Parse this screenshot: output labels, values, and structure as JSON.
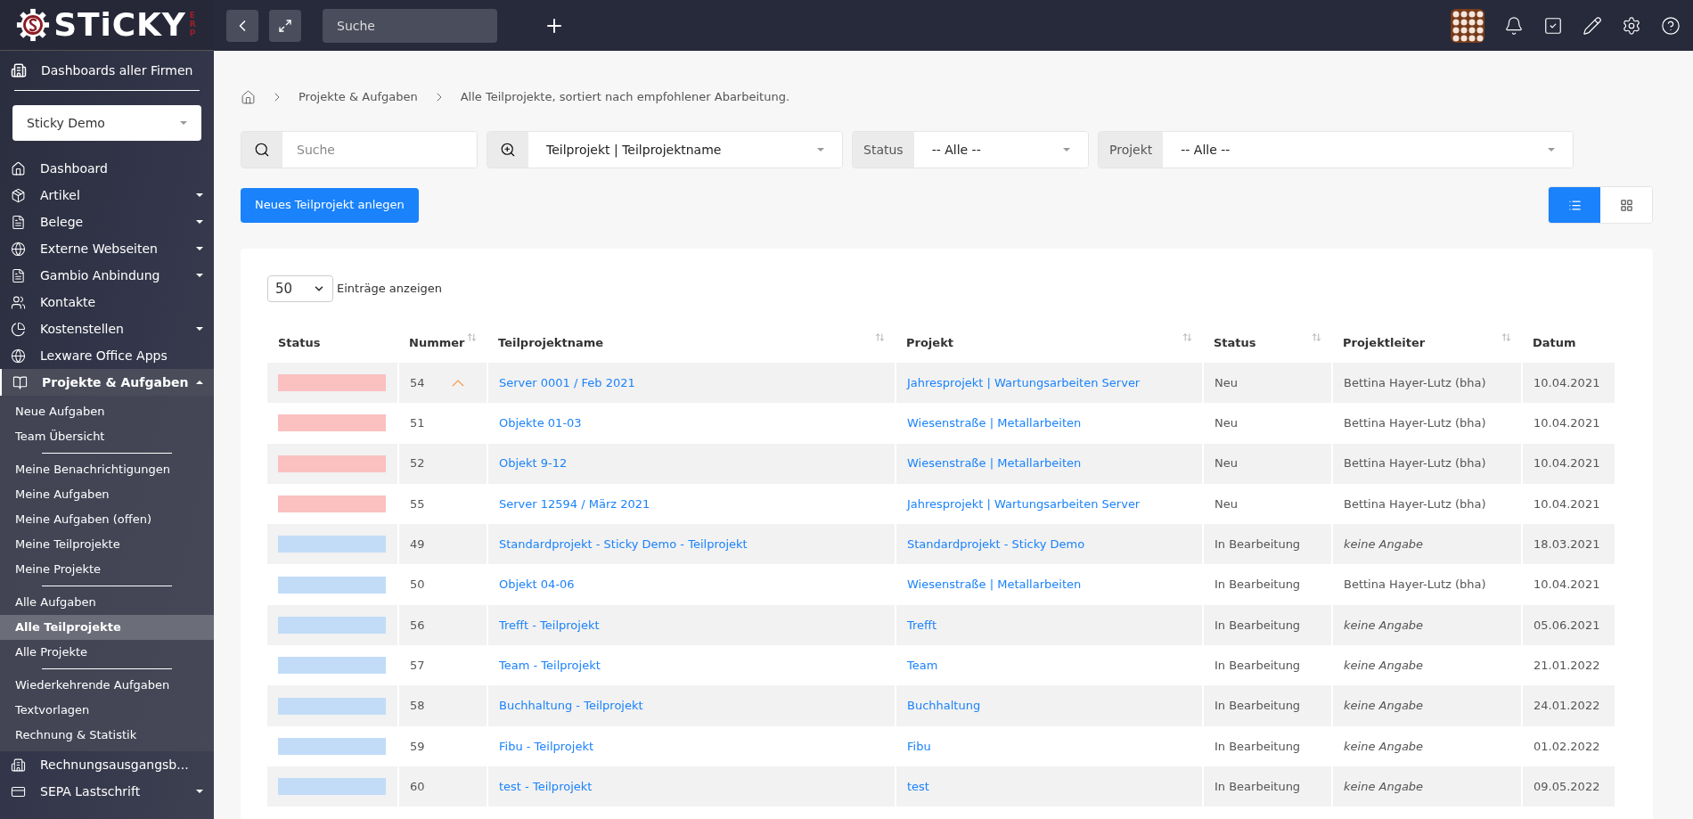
{
  "logo": {
    "text": "STiCKY",
    "suffix": "ERP"
  },
  "topbar": {
    "search_placeholder": "Suche"
  },
  "sidebar": {
    "dashboards_all": "Dashboards aller Firmen",
    "company": "Sticky Demo",
    "items": [
      {
        "label": "Dashboard",
        "kind": "home",
        "has_caret": false,
        "expanded": false
      },
      {
        "label": "Artikel",
        "kind": "box",
        "has_caret": true,
        "expanded": false
      },
      {
        "label": "Belege",
        "kind": "doc",
        "has_caret": true,
        "expanded": false
      },
      {
        "label": "Externe Webseiten",
        "kind": "globe",
        "has_caret": true,
        "expanded": false
      },
      {
        "label": "Gambio Anbindung",
        "kind": "doc",
        "has_caret": true,
        "expanded": false
      },
      {
        "label": "Kontakte",
        "kind": "users",
        "has_caret": false,
        "expanded": false
      },
      {
        "label": "Kostenstellen",
        "kind": "pie",
        "has_caret": true,
        "expanded": false
      },
      {
        "label": "Lexware Office Apps",
        "kind": "globe",
        "has_caret": false,
        "expanded": false
      },
      {
        "label": "Projekte & Aufgaben",
        "kind": "book",
        "has_caret": true,
        "expanded": true,
        "children": [
          {
            "label": "Neue Aufgaben",
            "selected": false
          },
          {
            "label": "Team Übersicht",
            "selected": false,
            "divider_after": true
          },
          {
            "label": "Meine Benachrichtigungen",
            "selected": false
          },
          {
            "label": "Meine Aufgaben",
            "selected": false
          },
          {
            "label": "Meine Aufgaben (offen)",
            "selected": false
          },
          {
            "label": "Meine Teilprojekte",
            "selected": false
          },
          {
            "label": "Meine Projekte",
            "selected": false,
            "divider_after": true
          },
          {
            "label": "Alle Aufgaben",
            "selected": false
          },
          {
            "label": "Alle Teilprojekte",
            "selected": true
          },
          {
            "label": "Alle Projekte",
            "selected": false,
            "divider_after": true
          },
          {
            "label": "Wiederkehrende Aufgaben",
            "selected": false
          },
          {
            "label": "Textvorlagen",
            "selected": false
          },
          {
            "label": "Rechnung & Statistik",
            "selected": false
          }
        ]
      },
      {
        "label": "Rechnungsausgangsb...",
        "kind": "building",
        "has_caret": false,
        "expanded": false
      },
      {
        "label": "SEPA Lastschrift",
        "kind": "card",
        "has_caret": true,
        "expanded": false
      }
    ]
  },
  "breadcrumb": [
    "Projekte & Aufgaben",
    "Alle Teilprojekte, sortiert nach empfohlener Abarbeitung."
  ],
  "filters": {
    "search_placeholder": "Suche",
    "field": "Teilprojekt | Teilprojektname",
    "status_label": "Status",
    "status_value": "-- Alle --",
    "project_label": "Projekt",
    "project_value": "-- Alle --"
  },
  "new_button": "Neues Teilprojekt anlegen",
  "view_toggle": [
    {
      "kind": "list",
      "selected": true
    },
    {
      "kind": "grid",
      "selected": false
    }
  ],
  "page_size": {
    "value": "50",
    "label": "Einträge anzeigen"
  },
  "table": {
    "columns": [
      {
        "label": "Status",
        "sortable": false
      },
      {
        "label": "Nummer",
        "sortable": true
      },
      {
        "label": "Teilprojektname",
        "sortable": true
      },
      {
        "label": "Projekt",
        "sortable": true
      },
      {
        "label": "Status",
        "sortable": true
      },
      {
        "label": "Projektleiter",
        "sortable": true
      },
      {
        "label": "Datum",
        "sortable": false
      }
    ],
    "rows": [
      {
        "color": "#fbc0c0",
        "number": "54",
        "priority_up": true,
        "name": "Server 0001 / Feb 2021",
        "project": "Jahresprojekt | Wartungsarbeiten Server",
        "status": "Neu",
        "leader": "Bettina Hayer-Lutz (bha)",
        "leader_unspecified": false,
        "date": "10.04.2021"
      },
      {
        "color": "#fbc0c0",
        "number": "51",
        "priority_up": false,
        "name": "Objekte 01-03",
        "project": "Wiesenstraße | Metallarbeiten",
        "status": "Neu",
        "leader": "Bettina Hayer-Lutz (bha)",
        "leader_unspecified": false,
        "date": "10.04.2021"
      },
      {
        "color": "#fbc0c0",
        "number": "52",
        "priority_up": false,
        "name": "Objekt 9-12",
        "project": "Wiesenstraße | Metallarbeiten",
        "status": "Neu",
        "leader": "Bettina Hayer-Lutz (bha)",
        "leader_unspecified": false,
        "date": "10.04.2021"
      },
      {
        "color": "#fbc0c0",
        "number": "55",
        "priority_up": false,
        "name": "Server 12594 / März 2021",
        "project": "Jahresprojekt | Wartungsarbeiten Server",
        "status": "Neu",
        "leader": "Bettina Hayer-Lutz (bha)",
        "leader_unspecified": false,
        "date": "10.04.2021"
      },
      {
        "color": "#c2dcf8",
        "number": "49",
        "priority_up": false,
        "name": "Standardprojekt - Sticky Demo - Teilprojekt",
        "project": "Standardprojekt - Sticky Demo",
        "status": "In Bearbeitung",
        "leader": "keine Angabe",
        "leader_unspecified": true,
        "date": "18.03.2021"
      },
      {
        "color": "#c2dcf8",
        "number": "50",
        "priority_up": false,
        "name": "Objekt 04-06",
        "project": "Wiesenstraße | Metallarbeiten",
        "status": "In Bearbeitung",
        "leader": "Bettina Hayer-Lutz (bha)",
        "leader_unspecified": false,
        "date": "10.04.2021"
      },
      {
        "color": "#c2dcf8",
        "number": "56",
        "priority_up": false,
        "name": "Trefft - Teilprojekt",
        "project": "Trefft",
        "status": "In Bearbeitung",
        "leader": "keine Angabe",
        "leader_unspecified": true,
        "date": "05.06.2021"
      },
      {
        "color": "#c2dcf8",
        "number": "57",
        "priority_up": false,
        "name": "Team - Teilprojekt",
        "project": "Team",
        "status": "In Bearbeitung",
        "leader": "keine Angabe",
        "leader_unspecified": true,
        "date": "21.01.2022"
      },
      {
        "color": "#c2dcf8",
        "number": "58",
        "priority_up": false,
        "name": "Buchhaltung - Teilprojekt",
        "project": "Buchhaltung",
        "status": "In Bearbeitung",
        "leader": "keine Angabe",
        "leader_unspecified": true,
        "date": "24.01.2022"
      },
      {
        "color": "#c2dcf8",
        "number": "59",
        "priority_up": false,
        "name": "Fibu - Teilprojekt",
        "project": "Fibu",
        "status": "In Bearbeitung",
        "leader": "keine Angabe",
        "leader_unspecified": true,
        "date": "01.02.2022"
      },
      {
        "color": "#c2dcf8",
        "number": "60",
        "priority_up": false,
        "name": "test - Teilprojekt",
        "project": "test",
        "status": "In Bearbeitung",
        "leader": "keine Angabe",
        "leader_unspecified": true,
        "date": "09.05.2022"
      }
    ]
  }
}
